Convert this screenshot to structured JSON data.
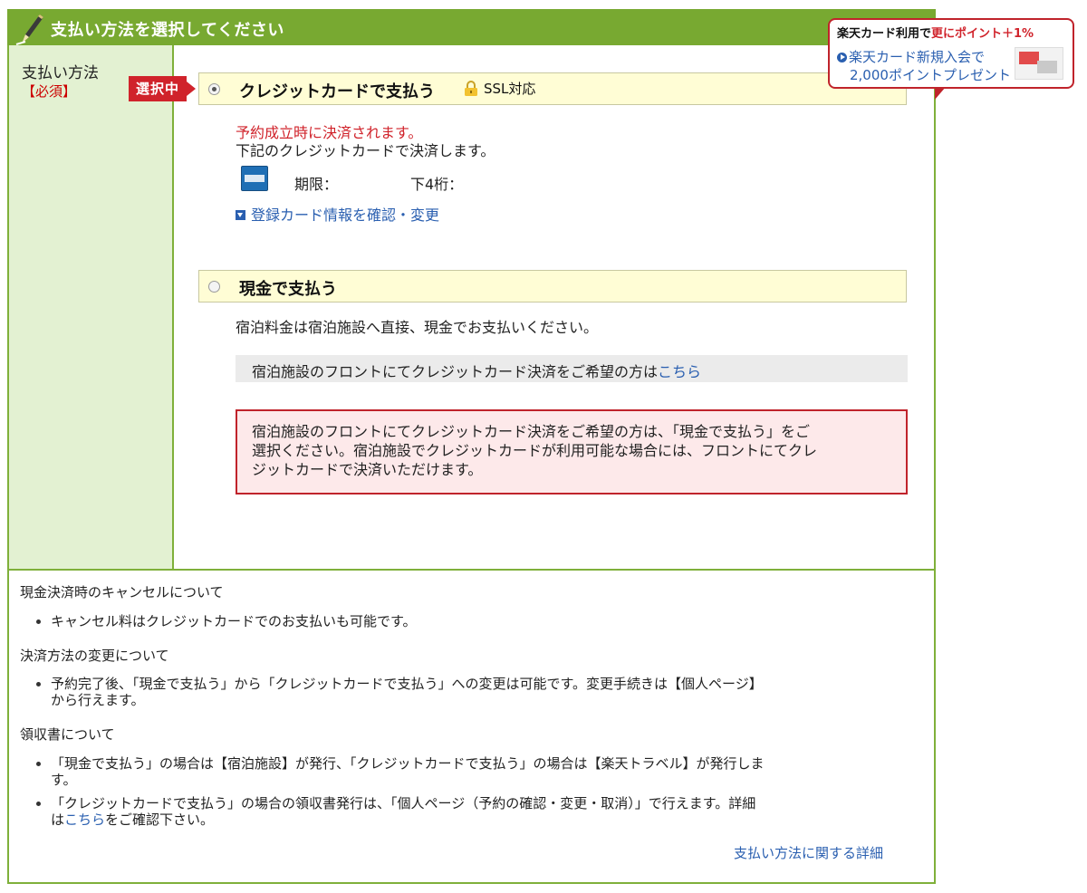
{
  "header": {
    "title": "支払い方法を選択してください"
  },
  "side": {
    "label": "支払い方法",
    "required": "【必須】"
  },
  "selected_tag": "選択中",
  "credit_option": {
    "label": "クレジットカードで支払う",
    "ssl": "SSL対応",
    "selected": true,
    "note_red": "予約成立時に決済されます。",
    "note": "下記のクレジットカードで決済します。",
    "expiry_label": "期限：",
    "last4_label": "下4桁：",
    "edit_link": "登録カード情報を確認・変更"
  },
  "cash_option": {
    "label": "現金で支払う",
    "selected": false,
    "note": "宿泊料金は宿泊施設へ直接、現金でお支払いください。",
    "front_prefix": "宿泊施設のフロントにてクレジットカード決済をご希望の方は",
    "front_link": "こちら",
    "warning_line1": "宿泊施設のフロントにてクレジットカード決済をご希望の方は、「現金で支払う」をご",
    "warning_line2": "選択ください。宿泊施設でクレジットカードが利用可能な場合には、フロントにてクレ",
    "warning_line3": "ジットカードで決済いただけます。"
  },
  "bottom": {
    "cancel_heading": "現金決済時のキャンセルについて",
    "cancel_item": "キャンセル料はクレジットカードでのお支払いも可能です。",
    "change_heading": "決済方法の変更について",
    "change_item_line1": "予約完了後、「現金で支払う」から「クレジットカードで支払う」への変更は可能です。変更手続きは【個人ページ】",
    "change_item_line2": "から行えます。",
    "receipt_heading": "領収書について",
    "receipt_item1_line1": "「現金で支払う」の場合は【宿泊施設】が発行、「クレジットカードで支払う」の場合は【楽天トラベル】が発行しま",
    "receipt_item1_line2": "す。",
    "receipt_item2_line1": "「クレジットカードで支払う」の場合の領収書発行は、「個人ページ（予約の確認・変更・取消）」で行えます。詳細",
    "receipt_item2_prefix": "は",
    "receipt_item2_link": "こちら",
    "receipt_item2_suffix": "をご確認下さい。",
    "detail_link": "支払い方法に関する詳細"
  },
  "promo": {
    "line1_a": "楽天カード利用で",
    "line1_b": "更にポイント＋1%",
    "line2": "楽天カード新規入会で",
    "line3": "2,000ポイントプレゼント"
  },
  "colors": {
    "accent_green": "#78a931",
    "side_green": "#e3f1d2",
    "alert_red": "#d0232b",
    "link_blue": "#2a5fb0"
  }
}
